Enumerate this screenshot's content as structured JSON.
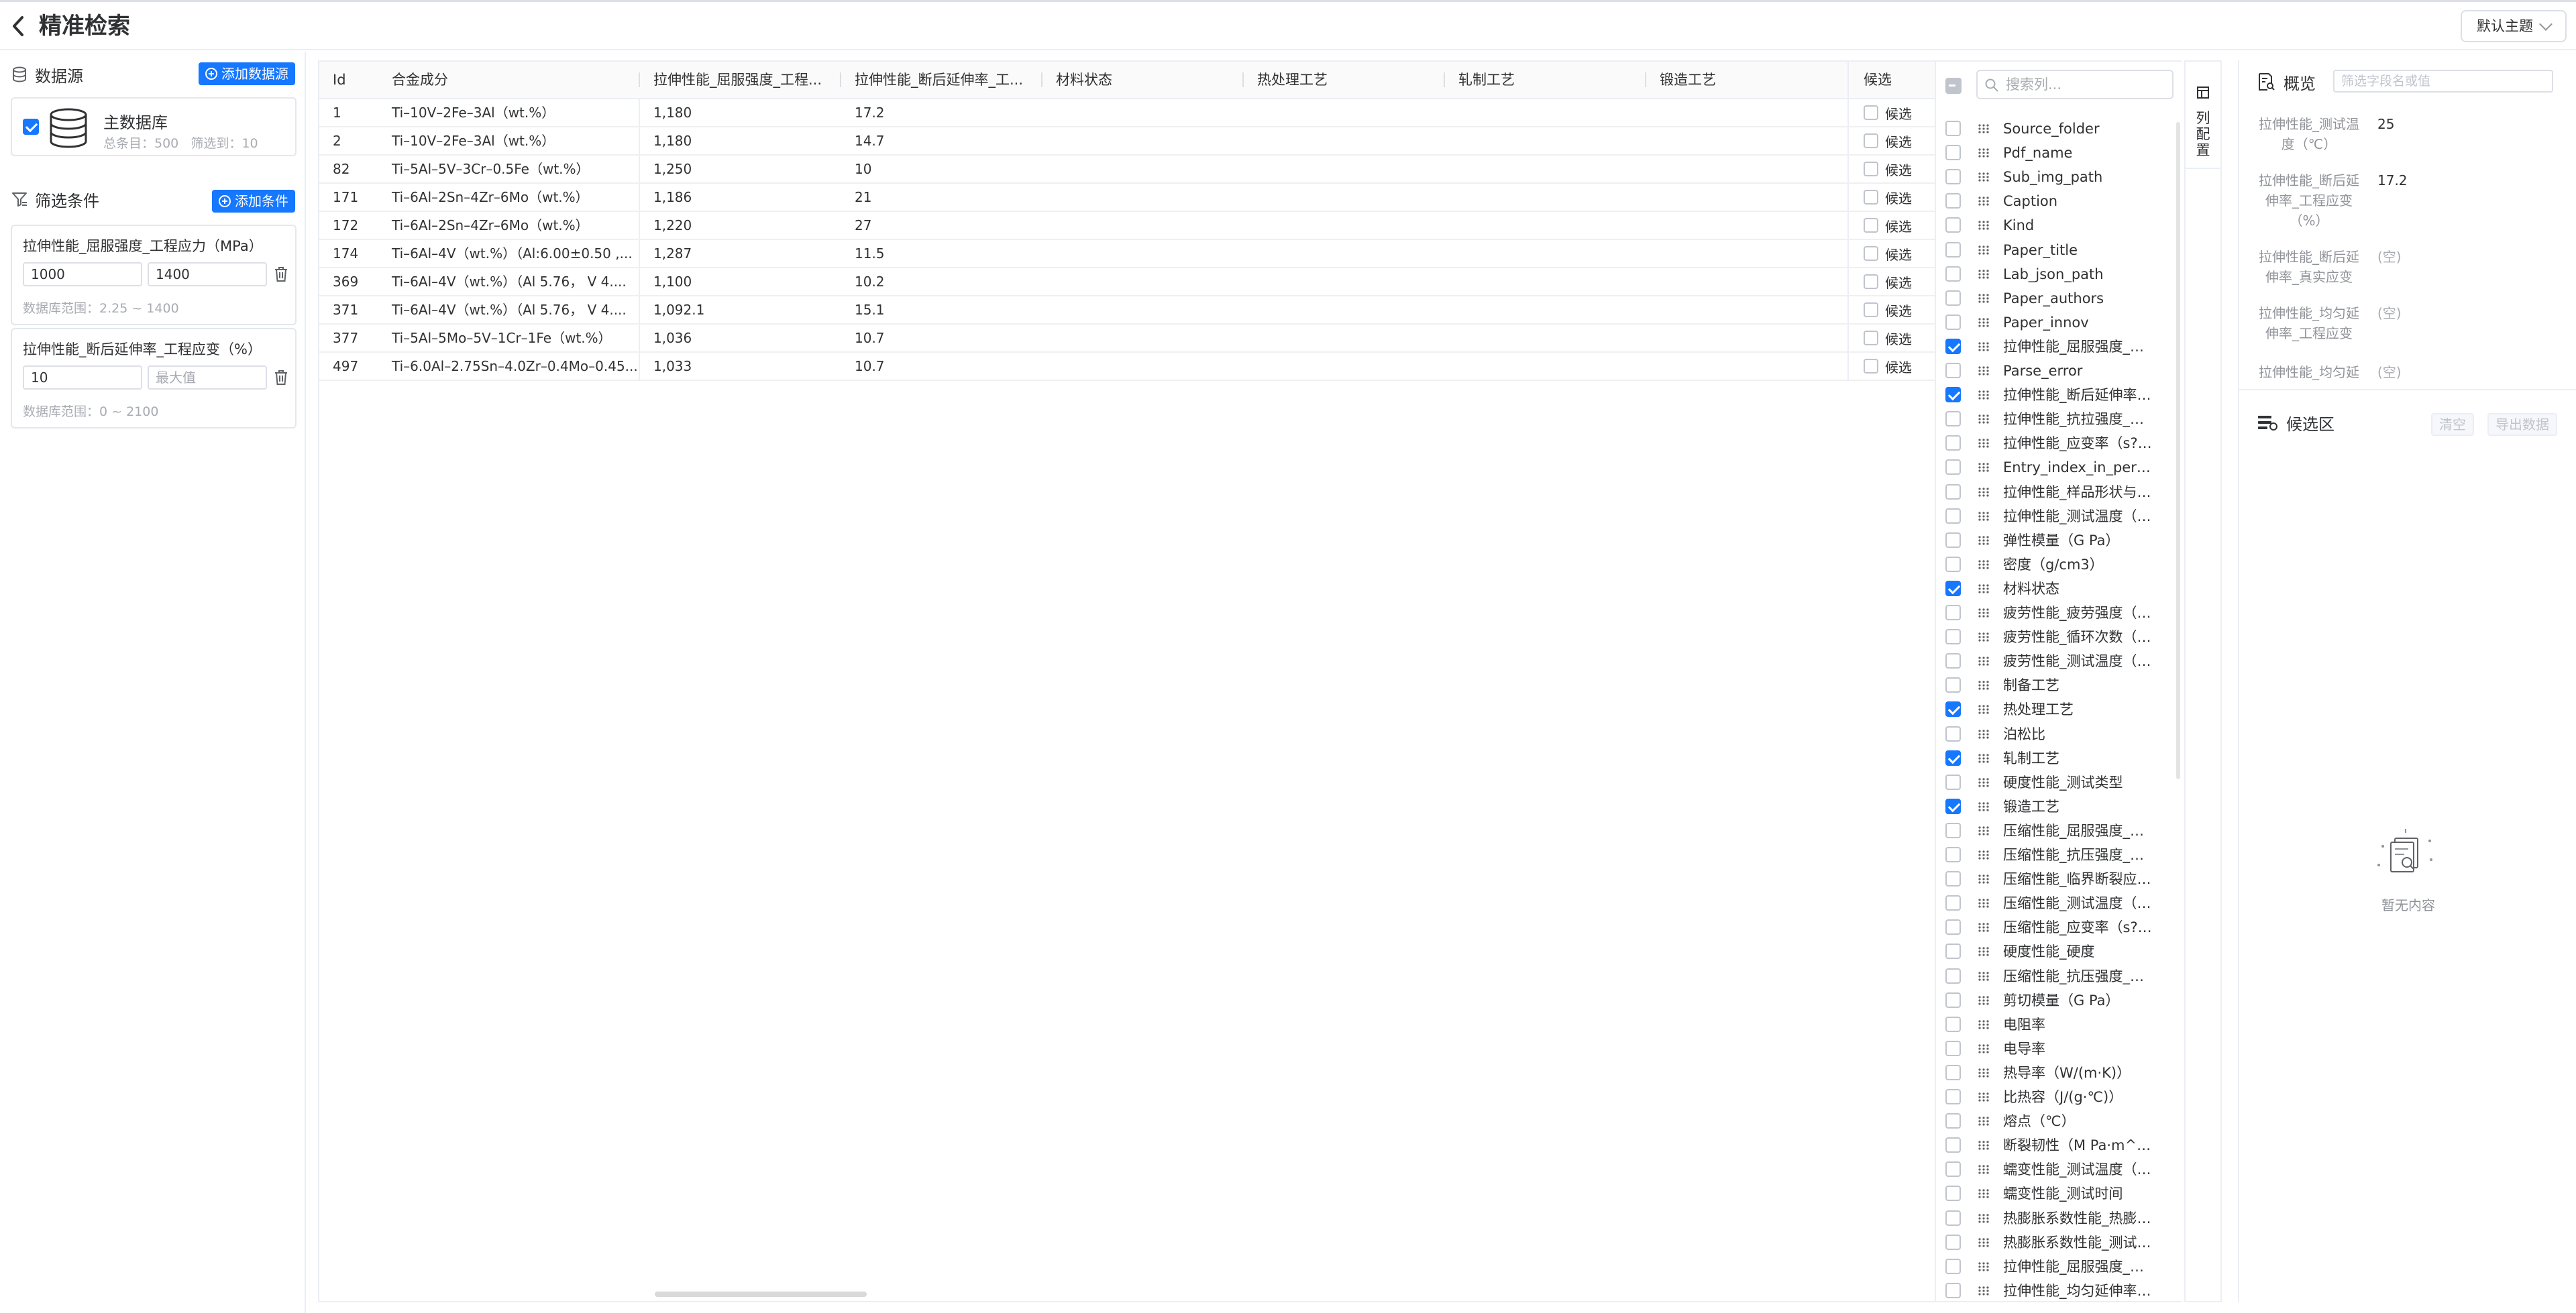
{
  "header": {
    "title": "精准检索",
    "theme_label": "默认主题"
  },
  "left": {
    "datasource_title": "数据源",
    "add_datasource_label": "添加数据源",
    "db": {
      "name": "主数据库",
      "stats": "总条目：500   筛选到：10",
      "checked": true
    },
    "filters_title": "筛选条件",
    "add_filter_label": "添加条件",
    "filters": [
      {
        "label": "拉伸性能_屈服强度_工程应力（MPa）",
        "min": "1000",
        "max": "1400",
        "max_placeholder": "",
        "range": "数据库范围：2.25 ~ 1400"
      },
      {
        "label": "拉伸性能_断后延伸率_工程应变（%）",
        "min": "10",
        "max": "",
        "max_placeholder": "最大值",
        "range": "数据库范围：0 ~ 2100"
      }
    ]
  },
  "table": {
    "columns": [
      "Id",
      "合金成分",
      "拉伸性能_屈服强度_工程...",
      "拉伸性能_断后延伸率_工...",
      "材料状态",
      "热处理工艺",
      "轧制工艺",
      "锻造工艺"
    ],
    "candidate_header": "候选",
    "candidate_label": "候选",
    "rows": [
      {
        "id": "1",
        "comp": "Ti–10V–2Fe–3Al（wt.%）",
        "ys": "1,180",
        "el": "17.2"
      },
      {
        "id": "2",
        "comp": "Ti–10V–2Fe–3Al（wt.%）",
        "ys": "1,180",
        "el": "14.7"
      },
      {
        "id": "82",
        "comp": "Ti–5Al–5V–3Cr–0.5Fe（wt.%）",
        "ys": "1,250",
        "el": "10"
      },
      {
        "id": "171",
        "comp": "Ti–6Al–2Sn–4Zr–6Mo（wt.%）",
        "ys": "1,186",
        "el": "21"
      },
      {
        "id": "172",
        "comp": "Ti–6Al–2Sn–4Zr–6Mo（wt.%）",
        "ys": "1,220",
        "el": "27"
      },
      {
        "id": "174",
        "comp": "Ti–6Al–4V（wt.%）（Al:6.00±0.50 ,...",
        "ys": "1,287",
        "el": "11.5"
      },
      {
        "id": "369",
        "comp": "Ti–6Al–4V（wt.%）（Al 5.76， V 4....",
        "ys": "1,100",
        "el": "10.2"
      },
      {
        "id": "371",
        "comp": "Ti–6Al–4V（wt.%）（Al 5.76， V 4....",
        "ys": "1,092.1",
        "el": "15.1"
      },
      {
        "id": "377",
        "comp": "Ti–5Al–5Mo–5V–1Cr–1Fe（wt.%）",
        "ys": "1,036",
        "el": "10.7"
      },
      {
        "id": "497",
        "comp": "Ti–6.0Al–2.75Sn–4.0Zr–0.4Mo–0.45...",
        "ys": "1,033",
        "el": "10.7"
      }
    ]
  },
  "columns_panel": {
    "search_placeholder": "搜索列...",
    "tab_label": "列配置",
    "items": [
      {
        "label": "Source_folder",
        "checked": false
      },
      {
        "label": "Pdf_name",
        "checked": false
      },
      {
        "label": "Sub_img_path",
        "checked": false
      },
      {
        "label": "Caption",
        "checked": false
      },
      {
        "label": "Kind",
        "checked": false
      },
      {
        "label": "Paper_title",
        "checked": false
      },
      {
        "label": "Lab_json_path",
        "checked": false
      },
      {
        "label": "Paper_authors",
        "checked": false
      },
      {
        "label": "Paper_innov",
        "checked": false
      },
      {
        "label": "拉伸性能_屈服强度_工...",
        "checked": true
      },
      {
        "label": "Parse_error",
        "checked": false
      },
      {
        "label": "拉伸性能_断后延伸率_...",
        "checked": true
      },
      {
        "label": "拉伸性能_抗拉强度_工...",
        "checked": false
      },
      {
        "label": "拉伸性能_应变率（s?1）",
        "checked": false
      },
      {
        "label": "Entry_index_in_perform...",
        "checked": false
      },
      {
        "label": "拉伸性能_样品形状与尺...",
        "checked": false
      },
      {
        "label": "拉伸性能_测试温度（℃...",
        "checked": false
      },
      {
        "label": "弹性模量（G Pa）",
        "checked": false
      },
      {
        "label": "密度（g/cm3）",
        "checked": false
      },
      {
        "label": "材料状态",
        "checked": true
      },
      {
        "label": "疲劳性能_疲劳强度（M ...",
        "checked": false
      },
      {
        "label": "疲劳性能_循环次数（次...",
        "checked": false
      },
      {
        "label": "疲劳性能_测试温度（℃...",
        "checked": false
      },
      {
        "label": "制备工艺",
        "checked": false
      },
      {
        "label": "热处理工艺",
        "checked": true
      },
      {
        "label": "泊松比",
        "checked": false
      },
      {
        "label": "轧制工艺",
        "checked": true
      },
      {
        "label": "硬度性能_测试类型",
        "checked": false
      },
      {
        "label": "锻造工艺",
        "checked": true
      },
      {
        "label": "压缩性能_屈服强度_工...",
        "checked": false
      },
      {
        "label": "压缩性能_抗压强度_工...",
        "checked": false
      },
      {
        "label": "压缩性能_临界断裂应变...",
        "checked": false
      },
      {
        "label": "压缩性能_测试温度（℃...",
        "checked": false
      },
      {
        "label": "压缩性能_应变率（s?1）",
        "checked": false
      },
      {
        "label": "硬度性能_硬度",
        "checked": false
      },
      {
        "label": "压缩性能_抗压强度_真...",
        "checked": false
      },
      {
        "label": "剪切模量（G Pa）",
        "checked": false
      },
      {
        "label": "电阻率",
        "checked": false
      },
      {
        "label": "电导率",
        "checked": false
      },
      {
        "label": "热导率（W/(m·K)）",
        "checked": false
      },
      {
        "label": "比热容（J/(g·℃)）",
        "checked": false
      },
      {
        "label": "熔点（℃）",
        "checked": false
      },
      {
        "label": "断裂韧性（M Pa·m^0 5）",
        "checked": false
      },
      {
        "label": "蠕变性能_测试温度（℃...",
        "checked": false
      },
      {
        "label": "蠕变性能_测试时间",
        "checked": false
      },
      {
        "label": "热膨胀系数性能_热膨胀...",
        "checked": false
      },
      {
        "label": "热膨胀系数性能_测试温...",
        "checked": false
      },
      {
        "label": "拉伸性能_屈服强度_真...",
        "checked": false
      },
      {
        "label": "拉伸性能_均匀延伸率_...",
        "checked": false
      }
    ]
  },
  "right": {
    "overview_title": "概览",
    "overview_placeholder": "筛选字段名或值",
    "overview_rows": [
      {
        "key": "拉伸性能_测试温度（℃）",
        "val": "25",
        "empty": false
      },
      {
        "key": "拉伸性能_断后延伸率_工程应变（%）",
        "val": "17.2",
        "empty": false
      },
      {
        "key": "拉伸性能_断后延伸率_真实应变",
        "val": "(空)",
        "empty": true
      },
      {
        "key": "拉伸性能_均匀延伸率_工程应变",
        "val": "(空)",
        "empty": true
      },
      {
        "key": "拉伸性能_均匀延",
        "val": "(空)",
        "empty": true
      }
    ],
    "candidates_title": "候选区",
    "clear_label": "清空",
    "export_label": "导出数据",
    "empty_text": "暂无内容"
  }
}
